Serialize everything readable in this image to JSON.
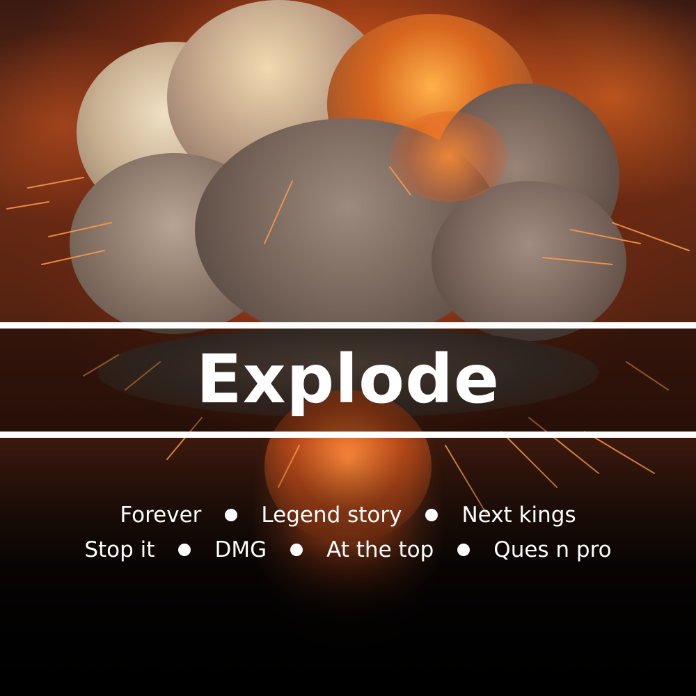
{
  "title": "Explode",
  "tags_row1": [
    "Forever",
    "Legend story",
    "Next kings"
  ],
  "tags_row2": [
    "Stop it",
    "DMG",
    "At the top",
    "Ques n pro"
  ],
  "colors": {
    "text": "#ffffff",
    "fire": "#e8692a",
    "smoke": "#8a7a6e"
  },
  "icons": [
    "explosion-illustration",
    "bullet-dot-icon"
  ]
}
